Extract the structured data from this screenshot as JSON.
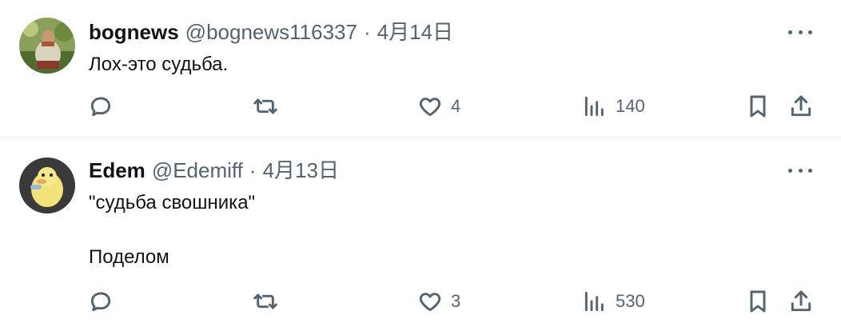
{
  "tweets": [
    {
      "name": "bognews",
      "handle": "@bognews116337",
      "separator": "·",
      "date": "4月14日",
      "text": "Лох-это судьба.",
      "likes": "4",
      "views": "140",
      "avatar_colors": [
        "#7a8c4a",
        "#c9a55f",
        "#3e5a2a"
      ]
    },
    {
      "name": "Edem",
      "handle": "@Edemiff",
      "separator": "·",
      "date": "4月13日",
      "text": "\"судьба свошника\"\n\nПоделом",
      "likes": "3",
      "views": "530",
      "avatar_colors": [
        "#3a3a3a",
        "#f2e27a",
        "#e9c94a"
      ]
    }
  ],
  "icons": {
    "reply": "reply-icon",
    "retweet": "retweet-icon",
    "like": "heart-icon",
    "views": "views-icon",
    "bookmark": "bookmark-icon",
    "share": "share-icon",
    "more": "more-icon"
  },
  "colors": {
    "text": "#0f1419",
    "secondary": "#536471",
    "divider": "#eff3f4"
  }
}
